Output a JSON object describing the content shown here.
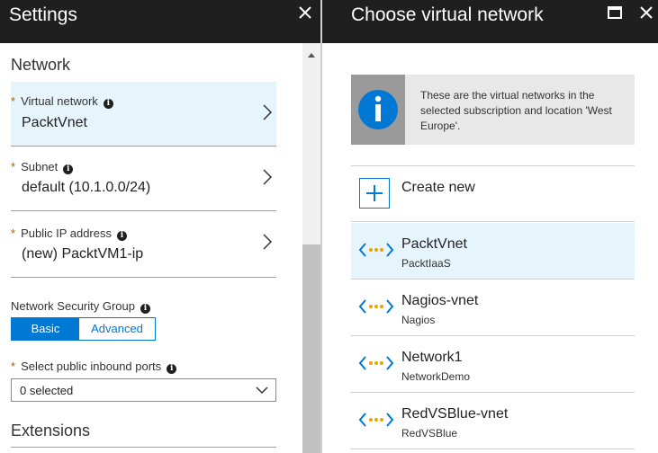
{
  "settings_blade": {
    "title": "Settings",
    "network_section_title": "Network",
    "fields": [
      {
        "label": "Virtual network",
        "required_marker": "*",
        "value": "PacktVnet"
      },
      {
        "label": "Subnet",
        "required_marker": "*",
        "value": "default (10.1.0.0/24)"
      },
      {
        "label": "Public IP address",
        "required_marker": "*",
        "value": "(new) PacktVM1-ip"
      }
    ],
    "nsg": {
      "label": "Network Security Group",
      "options": [
        "Basic",
        "Advanced"
      ],
      "selected": "Basic"
    },
    "inbound_ports": {
      "label": "Select public inbound ports",
      "required_marker": "*",
      "value": "0 selected"
    },
    "extensions_section_title": "Extensions",
    "icons": {
      "info": "info-icon",
      "close": "close-icon",
      "chevron": "chevron-right-icon",
      "dropdown": "chevron-down-icon"
    }
  },
  "vnet_blade": {
    "title": "Choose virtual network",
    "info_message": "These are the virtual networks in the selected subscription and location 'West Europe'.",
    "create_new_label": "Create new",
    "networks": [
      {
        "name": "PacktVnet",
        "resource_group": "PacktIaaS",
        "selected": true
      },
      {
        "name": "Nagios-vnet",
        "resource_group": "Nagios",
        "selected": false
      },
      {
        "name": "Network1",
        "resource_group": "NetworkDemo",
        "selected": false
      },
      {
        "name": "RedVSBlue-vnet",
        "resource_group": "RedVSBlue",
        "selected": false
      }
    ]
  },
  "colors": {
    "header_bg": "#1f1f1f",
    "accent_blue": "#0078d4",
    "selected_bg": "#e6f4fb",
    "required_star": "#a66100",
    "vnet_icon_brackets": "#0078d4",
    "vnet_icon_dots": "#e8a400"
  }
}
